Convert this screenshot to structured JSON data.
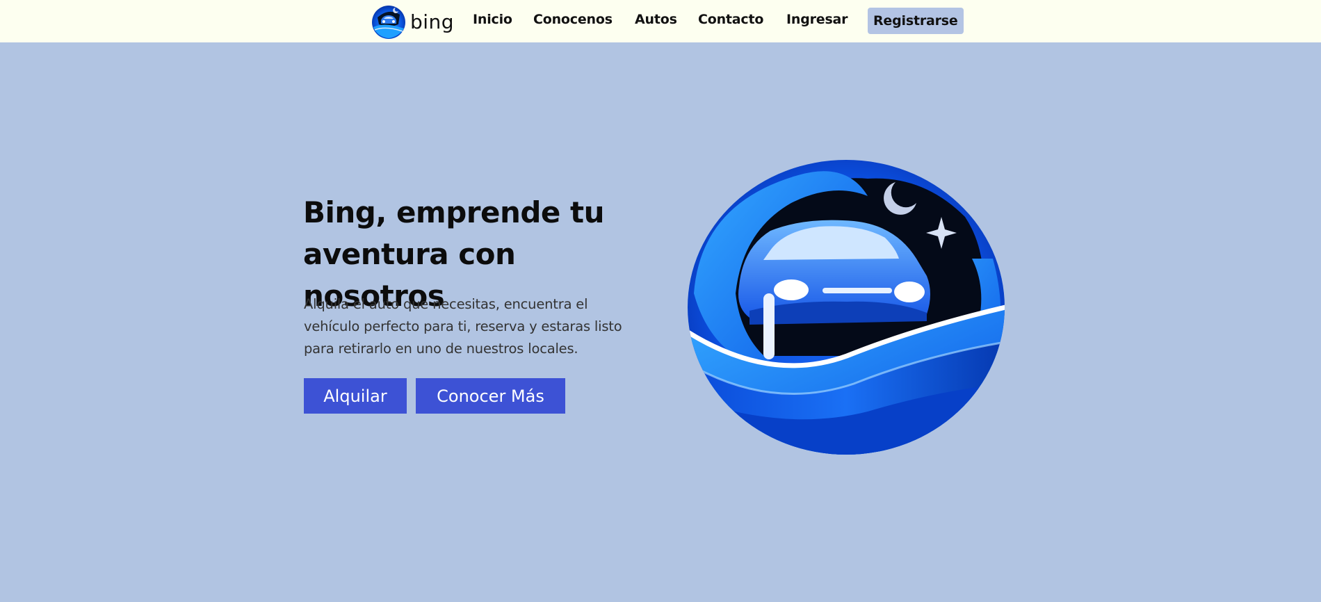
{
  "navbar": {
    "brand_name": "bing",
    "logo_icon": "car-wave-logo-icon",
    "links": [
      {
        "label": "Inicio"
      },
      {
        "label": "Conocenos"
      },
      {
        "label": "Autos"
      },
      {
        "label": "Contacto"
      },
      {
        "label": "Ingresar"
      },
      {
        "label": "Registrarse"
      }
    ]
  },
  "hero": {
    "title": "Bing, emprende tu aventura con nosotros",
    "description": "Alquila el auto que necesitas, encuentra el vehículo perfecto para ti, reserva y estaras listo para retirarlo en uno de nuestros locales.",
    "primary_button": "Alquilar",
    "secondary_button": "Conocer Más",
    "image_icon": "car-wave-illustration-icon"
  },
  "colors": {
    "page_background": "#b1c4e2",
    "navbar_background": "#fdfff0",
    "button_background": "#3d52d5",
    "register_highlight": "#b3c4e4"
  }
}
